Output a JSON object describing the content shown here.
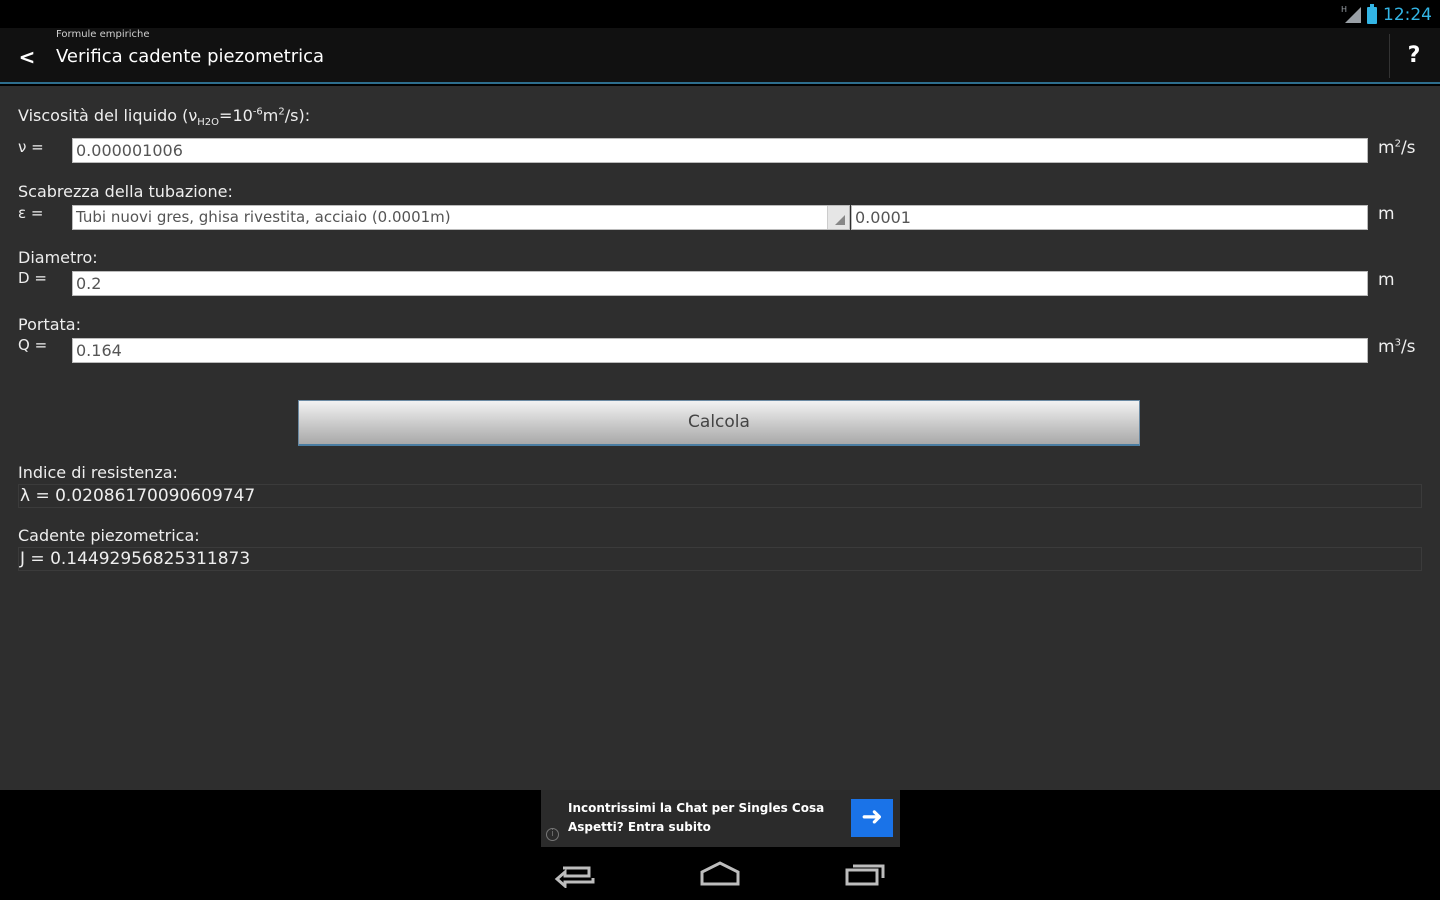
{
  "status_bar": {
    "time": "12:24",
    "network_label": "H"
  },
  "action_bar": {
    "back_label": "<",
    "subtitle": "Formule empiriche",
    "title": "Verifica cadente piezometrica",
    "help_label": "?"
  },
  "form": {
    "viscosity": {
      "label_main": "Viscosità del liquido (ν",
      "label_sub": "H2O",
      "label_mid": "=10",
      "label_exp": "-6",
      "label_unit": "m",
      "label_unit_exp": "2",
      "label_end": "/s):",
      "symbol": "ν =",
      "value": "0.000001006",
      "unit": "m",
      "unit_exp": "2",
      "unit_end": "/s"
    },
    "roughness": {
      "label": "Scabrezza della tubazione:",
      "symbol": "ε =",
      "selected_option": "Tubi nuovi gres, ghisa rivestita, acciaio (0.0001m)",
      "value": "0.0001",
      "unit": "m"
    },
    "diameter": {
      "label": "Diametro:",
      "symbol": "D =",
      "value": "0.2",
      "unit": "m"
    },
    "flow": {
      "label": "Portata:",
      "symbol": "Q =",
      "value": "0.164",
      "unit": "m",
      "unit_exp": "3",
      "unit_end": "/s"
    },
    "calculate_label": "Calcola"
  },
  "results": {
    "resistance": {
      "label": "Indice di resistenza:",
      "value": "λ = 0.020861700906097​47"
    },
    "gradient": {
      "label": "Cadente piezometrica:",
      "value": "J = 0.14492956825311873"
    }
  },
  "ad": {
    "text": "Incontrissimi la Chat per Singles Cosa Aspetti? Entra subito",
    "info_label": "i",
    "arrow_label": "➜"
  },
  "colors": {
    "accent": "#33b5e5",
    "content_bg": "#2e2e2e",
    "ad_button": "#1a73e8"
  }
}
